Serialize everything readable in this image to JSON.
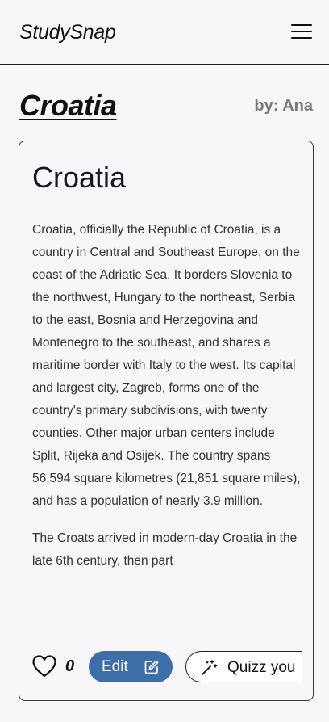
{
  "header": {
    "brand": "StudySnap",
    "menu_icon": "hamburger-menu-icon"
  },
  "page": {
    "title": "Croatia",
    "author": "by: Ana"
  },
  "card": {
    "title": "Croatia",
    "paragraphs": [
      "Croatia, officially the Republic of Croatia, is a country in Central and Southeast Europe, on the coast of the Adriatic Sea. It borders Slovenia to the northwest, Hungary to the northeast, Serbia to the east, Bosnia and Herzegovina and Montenegro to the southeast, and shares a maritime border with Italy to the west. Its capital and largest city, Zagreb, forms one of the country's primary subdivisions, with twenty counties. Other major urban centers include Split, Rijeka and Osijek. The country spans 56,594 square kilometres (21,851 square miles), and has a population of nearly 3.9 million.",
      "The Croats arrived in modern-day Croatia in the late 6th century, then part"
    ]
  },
  "actions": {
    "like_icon": "heart-icon",
    "like_count": "0",
    "edit_label": "Edit",
    "edit_icon": "edit-icon",
    "quiz_label": "Quizz you",
    "quiz_icon": "magic-wand-icon"
  },
  "colors": {
    "background": "#f8f6f8",
    "accent": "#3d6ea8",
    "border": "#3a3d4a",
    "author": "#777777"
  }
}
